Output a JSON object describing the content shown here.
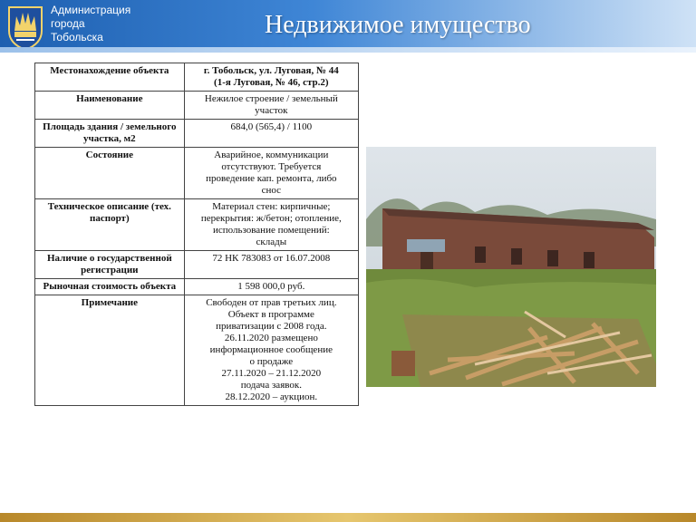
{
  "header": {
    "org_lines": [
      "Администрация",
      "города",
      "Тобольска"
    ],
    "title": "Недвижимое имущество"
  },
  "emblem": {
    "icon": "tobolsk-coat-of-arms-icon",
    "colors": [
      "#1e4f9e",
      "#f2d36b",
      "#ffffff"
    ]
  },
  "table": {
    "rows": [
      {
        "label": "Местонахождение объекта",
        "value_lines": [
          "г. Тобольск, ул. Луговая, № 44",
          "(1-я Луговая, № 46, стр.2)"
        ],
        "value_bold": true
      },
      {
        "label": "Наименование",
        "value_lines": [
          "Нежилое строение / земельный",
          "участок"
        ]
      },
      {
        "label": "Площадь здания / земельного участка, м2",
        "value_lines": [
          "684,0 (565,4) / 1100"
        ]
      },
      {
        "label": "Состояние",
        "value_lines": [
          "Аварийное, коммуникации",
          "отсутствуют. Требуется",
          "проведение кап. ремонта, либо",
          "снос"
        ]
      },
      {
        "label": "Техническое описание (тех. паспорт)",
        "value_lines": [
          "Материал стен: кирпичные;",
          "перекрытия: ж/бетон; отопление,",
          "использование помещений:",
          "склады"
        ]
      },
      {
        "label": "Наличие о государственной регистрации",
        "value_lines": [
          "72 НК 783083 от 16.07.2008"
        ]
      },
      {
        "label": "Рыночная стоимость объекта",
        "value_lines": [
          "1 598 000,0 руб."
        ]
      },
      {
        "label": "Примечание",
        "value_lines": [
          "Свободен от прав третьих лиц.",
          "Объект в программе",
          "приватизации с 2008 года.",
          "26.11.2020 размещено",
          "информационное сообщение",
          "о продаже",
          "27.11.2020 – 21.12.2020",
          "подача заявок.",
          "28.12.2020 – аукцион."
        ]
      }
    ]
  },
  "photo": {
    "subject": "brick-warehouse-with-wood-debris",
    "colors": {
      "sky": "#cfd8df",
      "brick": "#7a4a3a",
      "grass": "#6f8a3c",
      "wood": "#b48a5a"
    }
  }
}
